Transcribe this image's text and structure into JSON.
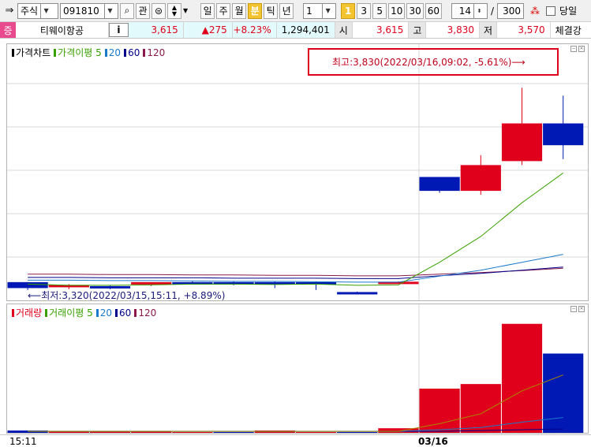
{
  "toolbar": {
    "market": "주식",
    "code": "091810",
    "interest_btn": "관",
    "periods": [
      "일",
      "주",
      "월",
      "분",
      "틱",
      "년"
    ],
    "active_period": "분",
    "interval_value": "1",
    "quick_intervals": [
      "1",
      "3",
      "5",
      "10",
      "30",
      "60"
    ],
    "active_interval": "1",
    "zoom_value": "14",
    "slash": "/",
    "count_value": "300",
    "same_day_label": "당일"
  },
  "quote": {
    "badge": "증",
    "name": "티웨이항공",
    "info_btn": "i",
    "price": "3,615",
    "change": "▲275",
    "change_pct": "+8.23%",
    "volume": "1,294,401",
    "open_label": "시",
    "open_value": "3,615",
    "high_label": "고",
    "high_value": "3,830",
    "low_label": "저",
    "low_value": "3,570",
    "strength_label": "체결강"
  },
  "price_panel": {
    "legend": [
      {
        "label": "가격차트",
        "color": "#000000"
      },
      {
        "label": "가격이평 5",
        "color": "#3aa000"
      },
      {
        "label": "20",
        "color": "#1a7acc"
      },
      {
        "label": "60",
        "color": "#00008b"
      },
      {
        "label": "120",
        "color": "#8b1a4a"
      }
    ],
    "annotation_high": "최고:3,830(2022/03/16,09:02, -5.61%)⟶",
    "annotation_low": "⟵최저:3,320(2022/03/15,15:11, +8.89%)"
  },
  "volume_panel": {
    "legend": [
      {
        "label": "거래량",
        "color": "#e0001b"
      },
      {
        "label": "거래이평 5",
        "color": "#3aa000"
      },
      {
        "label": "20",
        "color": "#1a7acc"
      },
      {
        "label": "60",
        "color": "#00008b"
      },
      {
        "label": "120",
        "color": "#8b1a4a"
      }
    ]
  },
  "xaxis": {
    "labels": [
      "15:11",
      "03/16"
    ]
  },
  "colors": {
    "up": "#e0001b",
    "down": "#0019b4",
    "ma5": "#3aa000",
    "ma20": "#1a7acc",
    "ma60": "#00008b",
    "ma120": "#8b1a4a",
    "grid": "#d8d8d8"
  },
  "chart_data": [
    {
      "type": "candlestick",
      "title": "가격차트",
      "ylim": [
        3300,
        3900
      ],
      "date_separator_after_index": 9,
      "candles": [
        {
          "o": 3340,
          "h": 3340,
          "l": 3320,
          "c": 3325
        },
        {
          "o": 3330,
          "h": 3335,
          "l": 3322,
          "c": 3333
        },
        {
          "o": 3330,
          "h": 3332,
          "l": 3322,
          "c": 3328
        },
        {
          "o": 3335,
          "h": 3340,
          "l": 3330,
          "c": 3340
        },
        {
          "o": 3340,
          "h": 3342,
          "l": 3335,
          "c": 3338
        },
        {
          "o": 3340,
          "h": 3342,
          "l": 3332,
          "c": 3335
        },
        {
          "o": 3340,
          "h": 3342,
          "l": 3325,
          "c": 3338
        },
        {
          "o": 3340,
          "h": 3342,
          "l": 3320,
          "c": 3338
        },
        {
          "o": 3315,
          "h": 3316,
          "l": 3310,
          "c": 3310
        },
        {
          "o": 3340,
          "h": 3342,
          "l": 3338,
          "c": 3341
        },
        {
          "o": 3605,
          "h": 3605,
          "l": 3565,
          "c": 3570
        },
        {
          "o": 3570,
          "h": 3660,
          "l": 3560,
          "c": 3635
        },
        {
          "o": 3645,
          "h": 3830,
          "l": 3635,
          "c": 3740
        },
        {
          "o": 3740,
          "h": 3810,
          "l": 3650,
          "c": 3685
        }
      ],
      "ma5": [
        3335,
        3332,
        3332,
        3333,
        3335,
        3335,
        3334,
        3335,
        3332,
        3333,
        3390,
        3455,
        3540,
        3615
      ],
      "ma20": [
        3345,
        3345,
        3344,
        3344,
        3343,
        3342,
        3342,
        3341,
        3340,
        3340,
        3355,
        3370,
        3390,
        3410
      ],
      "ma60": [
        3352,
        3352,
        3351,
        3351,
        3351,
        3350,
        3350,
        3350,
        3349,
        3349,
        3356,
        3362,
        3370,
        3378
      ],
      "ma120": [
        3360,
        3360,
        3359,
        3359,
        3358,
        3358,
        3357,
        3357,
        3356,
        3356,
        3360,
        3364,
        3369,
        3375
      ]
    },
    {
      "type": "bar",
      "title": "거래량",
      "ylim": [
        0,
        150
      ],
      "values": [
        3,
        2,
        2,
        2,
        1,
        1,
        3,
        1,
        1,
        6,
        58,
        64,
        143,
        104
      ],
      "up": [
        false,
        true,
        true,
        true,
        true,
        false,
        true,
        true,
        false,
        true,
        true,
        true,
        true,
        false
      ],
      "ma5": [
        2,
        2,
        2,
        2,
        2,
        2,
        2,
        2,
        2,
        2,
        12,
        25,
        55,
        76
      ],
      "ma20": [
        2,
        2,
        2,
        2,
        2,
        2,
        2,
        2,
        2,
        2,
        4,
        7,
        14,
        20
      ],
      "ma60": [
        2,
        2,
        2,
        2,
        2,
        2,
        2,
        2,
        2,
        2,
        2,
        3,
        4,
        5
      ]
    }
  ]
}
